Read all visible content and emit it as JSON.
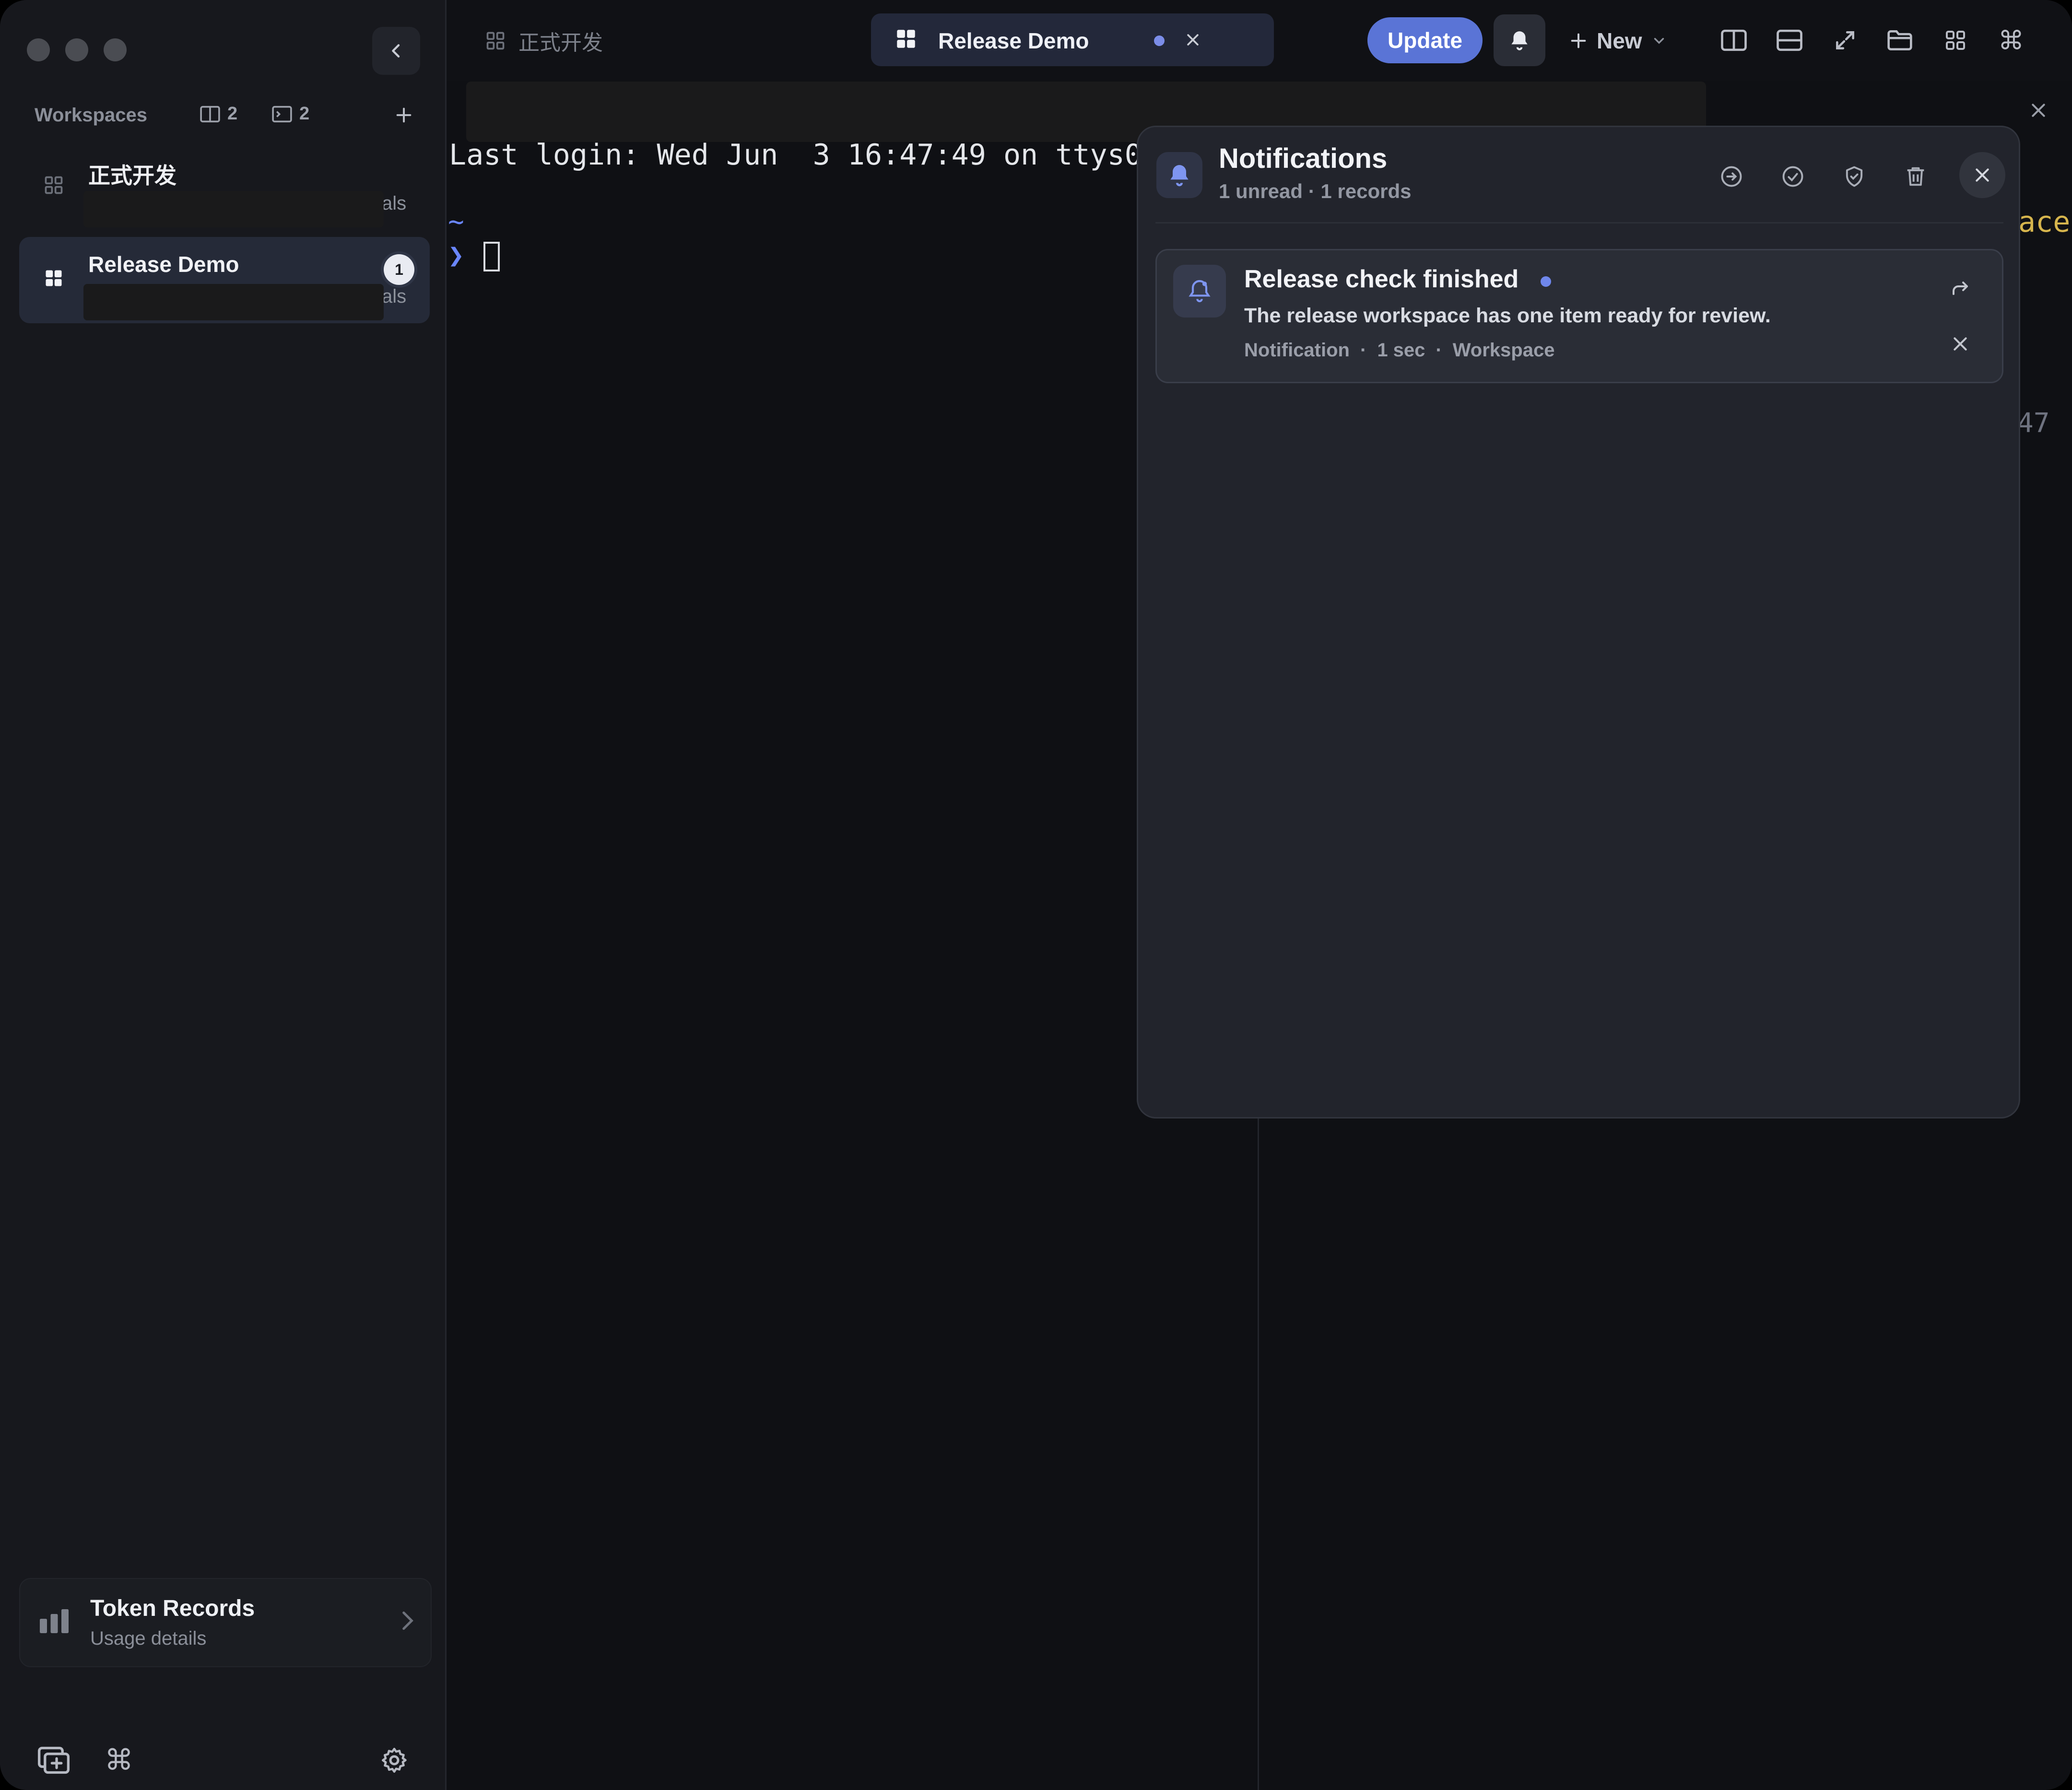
{
  "sidebar": {
    "workspaces_label": "Workspaces",
    "panes_count": "2",
    "terminals_count": "2",
    "items": [
      {
        "name": "正式开发",
        "tail": "als",
        "active": false
      },
      {
        "name": "Release Demo",
        "tail": "als",
        "badge": "1",
        "active": true
      }
    ],
    "token_card": {
      "title": "Token Records",
      "subtitle": "Usage details"
    }
  },
  "tabs": {
    "inactive_label": "正式开发",
    "active_label": "Release Demo"
  },
  "toolbar": {
    "update_label": "Update",
    "new_label": "New"
  },
  "terminal": {
    "last_login": "Last login: Wed Jun  3 16:47:49 on ttys0",
    "tilde": "~",
    "prompt": "❯",
    "right_peek_1": "ace",
    "right_peek_2": "47"
  },
  "notifications": {
    "title": "Notifications",
    "subtitle": "1 unread · 1 records",
    "items": [
      {
        "title": "Release check finished",
        "body": "The release workspace has one item ready for review.",
        "type": "Notification",
        "time": "1 sec",
        "source": "Workspace"
      }
    ]
  },
  "colors": {
    "accent": "#5a74d6",
    "unread_dot": "#6f87ec",
    "prompt": "#6a86ff"
  }
}
